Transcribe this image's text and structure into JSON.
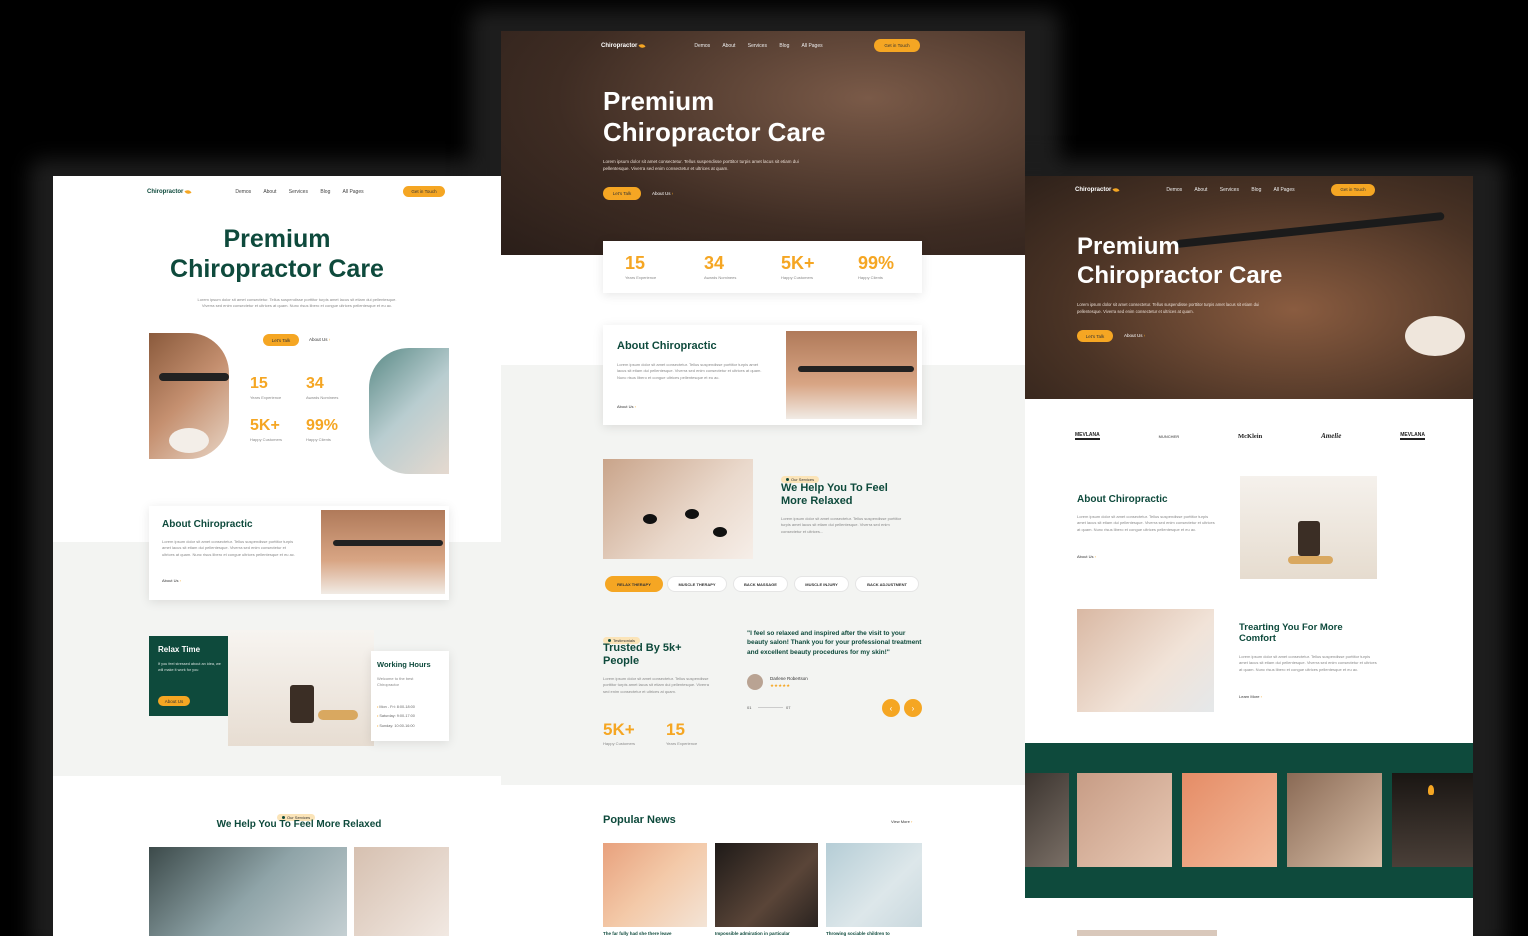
{
  "nav": {
    "logo": "Chiropractor",
    "links": [
      "Demos",
      "About",
      "Services",
      "Blog",
      "All Pages"
    ],
    "cta": "Get in Touch"
  },
  "hero": {
    "title_line1": "Premium",
    "title_line2": "Chiropractor Care",
    "body": "Lorem ipsum dolor sit amet consectetur. Tellus suspendisse porttitor turpis amet lacus sit etiam dui pellentesque. Viverra sed enim consectetur et ultrices at quam.",
    "body_left": "Lorem ipsum dolor sit amet consectetur. Tellus suspendisse porttitor turpis amet lacus sit etiam dui pellentesque. Viverra sed enim consectetur et ultrices at quam. Nunc risus libero et congue ultrices pellentesque et eu ac.",
    "primary_cta": "Let's Talk",
    "secondary_cta": "About Us"
  },
  "stats": [
    {
      "value": "15",
      "label": "Years Experience"
    },
    {
      "value": "34",
      "label": "Awards Nominees"
    },
    {
      "value": "5K+",
      "label": "Happy Customers"
    },
    {
      "value": "99%",
      "label": "Happy Clients"
    }
  ],
  "about": {
    "title": "About Chiropractic",
    "body": "Lorem ipsum dolor sit amet consectetur. Tellus suspendisse porttitor turpis amet lacus sit etiam dui pellentesque. Viverra sed enim consectetur et ultrices at quam. Nunc risus libero et congue ultrices pellentesque et eu ac.",
    "link": "About Us"
  },
  "relax": {
    "title": "Relax Time",
    "body": "If you feel stressed about an idea, we will make it work for you",
    "cta": "About Us"
  },
  "hours": {
    "title": "Working Hours",
    "subtitle": "Welcome to the best Chiropractor",
    "rows": [
      "Mon - Fri: 8:00-18:00",
      "Saturday: 9:00-17:00",
      "Sunday: 10:00-16:00"
    ]
  },
  "services": {
    "badge": "Our Services",
    "title": "We Help You To Feel More Relaxed",
    "title_line1": "We Help You To Feel",
    "title_line2": "More Relaxed",
    "body": "Lorem ipsum dolor sit amet consectetur. Tellus suspendisse porttitor turpis amet lacus sit etiam dui pellentesque. Viverra sed enim consectetur et ultrices...",
    "tabs": [
      "RELAX THERAPY",
      "MUSCLE THERAPY",
      "BACK MASSAGE",
      "MUSCLE INJURY",
      "BACK ADJUSTMENT"
    ]
  },
  "testimonials": {
    "badge": "Testimonials",
    "title_line1": "Trusted By 5k+",
    "title_line2": "People",
    "body": "Lorem ipsum dolor sit amet consectetur. Tellus suspendisse porttitor turpis amet lacus sit etiam dui pellentesque. Viverra sed enim consectetur et ultrices at quam.",
    "quote": "\"I feel so relaxed and inspired after the visit to your beauty salon! Thank you for your professional treatment and excellent beauty procedures for my skin!\"",
    "author": "Darlene Robertson",
    "stars": "★★★★★",
    "pager_start": "01",
    "pager_end": "07",
    "stat1_value": "5K+",
    "stat1_label": "Happy Customers",
    "stat2_value": "15",
    "stat2_label": "Years Experience"
  },
  "news": {
    "title": "Popular News",
    "link": "View More",
    "captions": [
      "The far fully had she there leave",
      "Impossible admiration in particular",
      "Throwing sociable children to"
    ]
  },
  "brands": [
    "MEVLANA",
    "MUNCHER",
    "McKlein",
    "Amelie",
    "MEVLANA"
  ],
  "treating": {
    "title_line1": "Trearting You For More",
    "title_line2": "Comfort",
    "body": "Lorem ipsum dolor sit amet consectetur. Tellus suspendisse porttitor turpis amet lacus sit etiam dui pellentesque. Viverra sed enim consectetur et ultrices at quam. Nunc risus libero et congue ultrices pellentesque et eu ac.",
    "link": "Learn More"
  },
  "colors": {
    "accent": "#f5a623",
    "brand_green": "#0e4a3c",
    "dark_bg": "#000000"
  }
}
